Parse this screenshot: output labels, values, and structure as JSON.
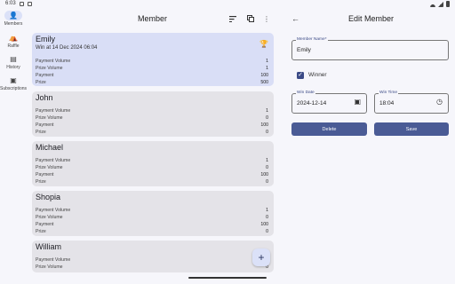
{
  "status": {
    "time": "6:03"
  },
  "rail": {
    "items": [
      {
        "label": "Members",
        "icon": "person-icon",
        "glyph": "👤"
      },
      {
        "label": "Raffle",
        "icon": "raffle-icon",
        "glyph": "⛺"
      },
      {
        "label": "History",
        "icon": "history-icon",
        "glyph": "▤"
      },
      {
        "label": "Subscriptions",
        "icon": "subscriptions-icon",
        "glyph": "▣"
      }
    ]
  },
  "list": {
    "title": "Member",
    "members": [
      {
        "name": "Emily",
        "win_at": "Win at 14 Dec 2024 06:04",
        "winner": true,
        "rows": [
          {
            "k": "Payment Volume",
            "v": "1"
          },
          {
            "k": "Prize Volume",
            "v": "1"
          },
          {
            "k": "Payment",
            "v": "100"
          },
          {
            "k": "Prize",
            "v": "500"
          }
        ]
      },
      {
        "name": "John",
        "rows": [
          {
            "k": "Payment Volume",
            "v": "1"
          },
          {
            "k": "Prize Volume",
            "v": "0"
          },
          {
            "k": "Payment",
            "v": "100"
          },
          {
            "k": "Prize",
            "v": "0"
          }
        ]
      },
      {
        "name": "Michael",
        "rows": [
          {
            "k": "Payment Volume",
            "v": "1"
          },
          {
            "k": "Prize Volume",
            "v": "0"
          },
          {
            "k": "Payment",
            "v": "100"
          },
          {
            "k": "Prize",
            "v": "0"
          }
        ]
      },
      {
        "name": "Shopia",
        "rows": [
          {
            "k": "Payment Volume",
            "v": "1"
          },
          {
            "k": "Prize Volume",
            "v": "0"
          },
          {
            "k": "Payment",
            "v": "100"
          },
          {
            "k": "Prize",
            "v": "0"
          }
        ]
      },
      {
        "name": "William",
        "rows": [
          {
            "k": "Payment Volume",
            "v": "1"
          },
          {
            "k": "Prize Volume",
            "v": "0"
          }
        ]
      }
    ]
  },
  "detail": {
    "title": "Edit Member",
    "member_name": {
      "label": "Member Name*",
      "value": "Emily"
    },
    "winner": {
      "label": "Winner",
      "checked": true
    },
    "win_date": {
      "label": "Win Date",
      "value": "2024-12-14"
    },
    "win_time": {
      "label": "Win Time",
      "value": "18:04"
    },
    "delete_label": "Delete",
    "save_label": "Save"
  },
  "colors": {
    "accent": "#4a5b95",
    "selected_card": "#d9def6",
    "card": "#e4e3e8"
  }
}
